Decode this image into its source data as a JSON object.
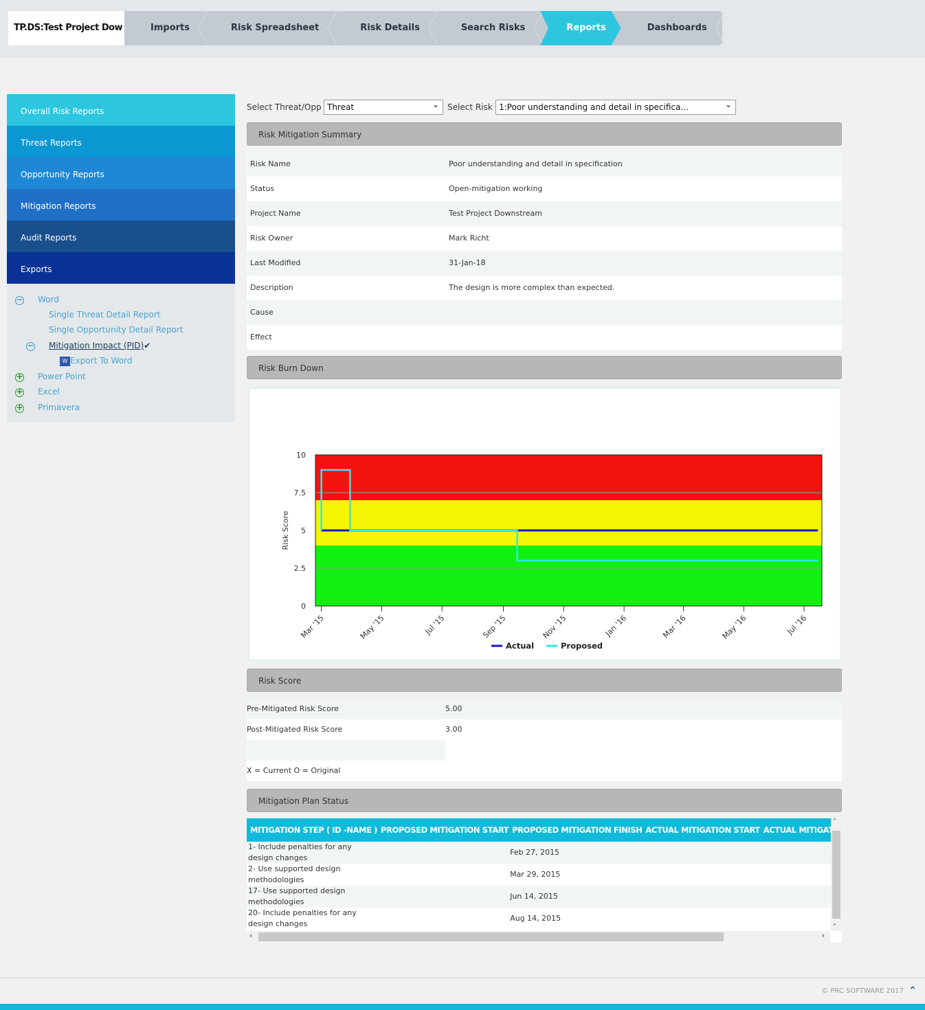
{
  "nav": {
    "project": "TP.DS:Test Project Dow",
    "tabs": [
      "Imports",
      "Risk Spreadsheet",
      "Risk Details",
      "Search Risks",
      "Reports",
      "Dashboards"
    ],
    "active": "Reports"
  },
  "sidebar": {
    "items": [
      {
        "label": "Overall Risk Reports",
        "color": "#2dc6df"
      },
      {
        "label": "Threat Reports",
        "color": "#0b97d1"
      },
      {
        "label": "Opportunity Reports",
        "color": "#1e88d6"
      },
      {
        "label": "Mitigation Reports",
        "color": "#1f6fc7"
      },
      {
        "label": "Audit Reports",
        "color": "#184f8c"
      },
      {
        "label": "Exports",
        "color": "#0a3296"
      }
    ],
    "tree": {
      "word": "Word",
      "single_threat": "Single Threat Detail Report",
      "single_opp": "Single Opportunity Detail Report",
      "mitigation_impact": "Mitigation Impact (PID)",
      "export_word": "Export To Word",
      "power_point": "Power Point",
      "excel": "Excel",
      "primavera": "Primavera"
    }
  },
  "filters": {
    "threat_label": "Select Threat/Opp :",
    "threat_value": "Threat",
    "risk_label": "Select Risk :",
    "risk_value": "1:Poor understanding and detail in specifica..."
  },
  "summary": {
    "title": "Risk Mitigation Summary",
    "rows": [
      [
        "Risk Name",
        "Poor understanding and detail in specification"
      ],
      [
        "Status",
        "Open-mitigation working"
      ],
      [
        "Project Name",
        "Test Project Downstream"
      ],
      [
        "Risk Owner",
        "Mark Richt"
      ],
      [
        "Last Modified",
        "31-Jan-18"
      ],
      [
        "Description",
        "The design is more complex than expected."
      ],
      [
        "Cause",
        ""
      ],
      [
        "Effect",
        ""
      ]
    ]
  },
  "burndown": {
    "title": "Risk Burn Down"
  },
  "chart_data": {
    "type": "line",
    "ylabel": "Risk Score",
    "ylim": [
      0,
      10
    ],
    "yticks": [
      "0",
      "2.5",
      "5",
      "7.5",
      "10"
    ],
    "xlim": [
      "2015-02-23",
      "2016-07-19"
    ],
    "xticks": [
      [
        "2015-03-01",
        "Mar '15"
      ],
      [
        "2015-05-01",
        "May '15"
      ],
      [
        "2015-07-01",
        "Jul '15"
      ],
      [
        "2015-09-01",
        "Sep '15"
      ],
      [
        "2015-11-01",
        "Nov '15"
      ],
      [
        "2016-01-01",
        "Jan '16"
      ],
      [
        "2016-03-01",
        "Mar '16"
      ],
      [
        "2016-05-01",
        "May '16"
      ],
      [
        "2016-07-01",
        "Jul '16"
      ]
    ],
    "bands": [
      {
        "from": 0,
        "to": 4,
        "color": "#12f012"
      },
      {
        "from": 4,
        "to": 7,
        "color": "#f4f505"
      },
      {
        "from": 7,
        "to": 10,
        "color": "#f2130f"
      }
    ],
    "series": [
      {
        "name": "Actual",
        "color": "#1616c8",
        "step": true,
        "points": [
          [
            "2015-03-01",
            5
          ],
          [
            "2016-07-15",
            5
          ]
        ]
      },
      {
        "name": "Proposed",
        "color": "#2fe8e8",
        "step": true,
        "points": [
          [
            "2015-03-01",
            5
          ],
          [
            "2015-03-01",
            9
          ],
          [
            "2015-03-30",
            9
          ],
          [
            "2015-03-30",
            5
          ],
          [
            "2015-09-15",
            5
          ],
          [
            "2015-09-15",
            3
          ],
          [
            "2016-07-15",
            3
          ]
        ]
      }
    ],
    "legend": "bottom"
  },
  "score": {
    "title": "Risk Score",
    "pre_label": "Pre-Mitigated Risk Score",
    "pre_value": "5.00",
    "post_label": "Post-Mitigated Risk Score",
    "post_value": "3.00",
    "note": "X = Current O = Original"
  },
  "plan": {
    "title": "Mitigation Plan Status",
    "columns": [
      "MITIGATION STEP ( ID -NAME )",
      "PROPOSED MITIGATION START",
      "PROPOSED MITIGATION FINISH",
      "ACTUAL MITIGATION START",
      "ACTUAL MITIGATION FINIS"
    ],
    "rows": [
      [
        "1- Include penalties for any design changes",
        "",
        "Feb 27, 2015",
        "",
        ""
      ],
      [
        "2- Use supported design methodologies",
        "",
        "Mar 29, 2015",
        "",
        ""
      ],
      [
        "17- Use supported design methodologies",
        "",
        "Jun 14, 2015",
        "",
        ""
      ],
      [
        "20- Include penalties for any design changes",
        "",
        "Aug 14, 2015",
        "",
        ""
      ]
    ]
  },
  "footer": {
    "copyright": "© PRC SOFTWARE 2017"
  }
}
